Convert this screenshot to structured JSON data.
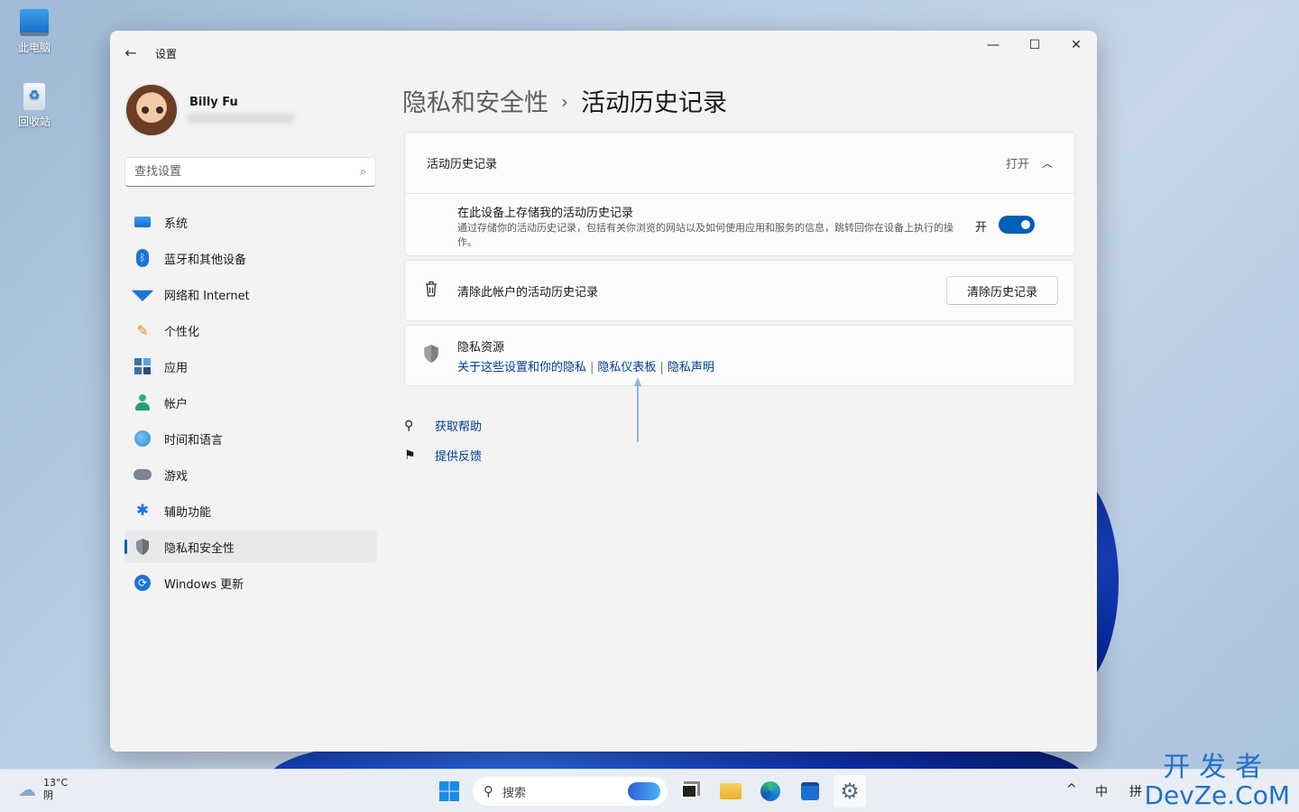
{
  "desktop": {
    "icons": [
      {
        "label": "此电脑"
      },
      {
        "label": "回收站"
      }
    ]
  },
  "window": {
    "title": "设置",
    "controls": {
      "minimize": "—",
      "maximize": "☐",
      "close": "✕"
    }
  },
  "user": {
    "name": "Billy Fu"
  },
  "search": {
    "placeholder": "查找设置"
  },
  "sidebar": {
    "items": [
      {
        "label": "系统",
        "icon": "monitor-icon"
      },
      {
        "label": "蓝牙和其他设备",
        "icon": "bluetooth-icon"
      },
      {
        "label": "网络和 Internet",
        "icon": "wifi-icon"
      },
      {
        "label": "个性化",
        "icon": "brush-icon"
      },
      {
        "label": "应用",
        "icon": "apps-icon"
      },
      {
        "label": "帐户",
        "icon": "person-icon"
      },
      {
        "label": "时间和语言",
        "icon": "globe-clock-icon"
      },
      {
        "label": "游戏",
        "icon": "gamepad-icon"
      },
      {
        "label": "辅助功能",
        "icon": "accessibility-icon"
      },
      {
        "label": "隐私和安全性",
        "icon": "shield-icon",
        "active": true
      },
      {
        "label": "Windows 更新",
        "icon": "update-icon"
      }
    ]
  },
  "breadcrumb": {
    "parent": "隐私和安全性",
    "separator": "›",
    "current": "活动历史记录"
  },
  "activity_card": {
    "title": "活动历史记录",
    "state": "打开",
    "store_title": "在此设备上存储我的活动历史记录",
    "store_desc": "通过存储你的活动历史记录，包括有关你浏览的网站以及如何使用应用和服务的信息，跳转回你在设备上执行的操作。",
    "toggle_label": "开",
    "toggle_on": true
  },
  "clear_card": {
    "text": "清除此帐户的活动历史记录",
    "button": "清除历史记录"
  },
  "privacy_card": {
    "title": "隐私资源",
    "links": [
      "关于这些设置和你的隐私",
      "隐私仪表板",
      "隐私声明"
    ],
    "separator": "|"
  },
  "help_links": [
    {
      "label": "获取帮助",
      "icon": "help-icon"
    },
    {
      "label": "提供反馈",
      "icon": "feedback-icon"
    }
  ],
  "taskbar": {
    "weather_temp": "13°C",
    "weather_cond": "阴",
    "search_placeholder": "搜索",
    "tray": {
      "chevron": "^",
      "ime_lang": "中",
      "ime_mode": "拼"
    }
  },
  "watermark": {
    "line1": "开发者",
    "line2": "DevZe.CoM"
  },
  "colors": {
    "accent": "#005fb8",
    "link": "#003e92"
  }
}
